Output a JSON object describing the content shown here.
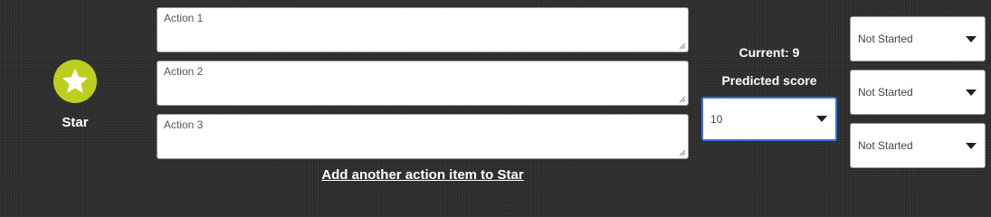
{
  "category": {
    "label": "Star",
    "icon": "star-icon",
    "badge_color": "#bccf1f"
  },
  "actions": {
    "items": [
      {
        "placeholder": "Action 1",
        "value": ""
      },
      {
        "placeholder": "Action 2",
        "value": ""
      },
      {
        "placeholder": "Action 3",
        "value": ""
      }
    ],
    "add_link": "Add another action item to Star"
  },
  "score": {
    "current_label": "Current: 9",
    "predicted_label": "Predicted score",
    "predicted_value": "10"
  },
  "statuses": [
    {
      "value": "Not Started"
    },
    {
      "value": "Not Started"
    },
    {
      "value": "Not Started"
    }
  ],
  "colors": {
    "background": "#2b2b2b",
    "focus_border": "#3a6fd8"
  }
}
